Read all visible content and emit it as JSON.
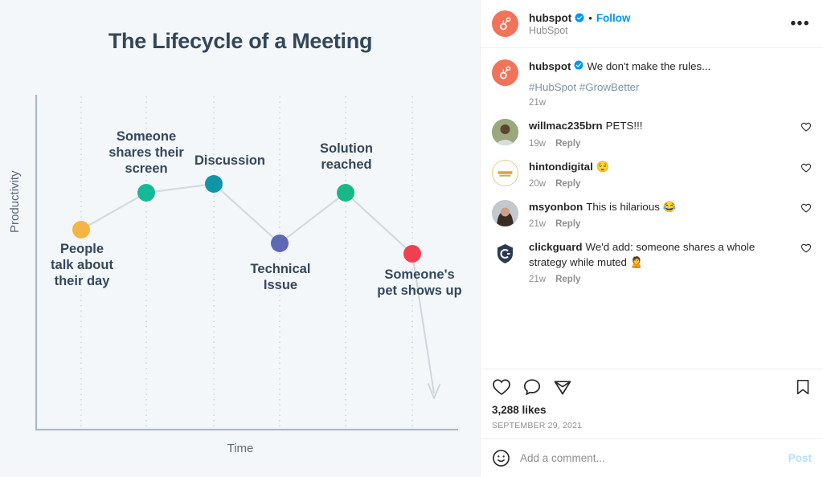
{
  "chart_data": {
    "type": "line",
    "title": "The Lifecycle of a Meeting",
    "xlabel": "Time",
    "ylabel": "Productivity",
    "grid": "vertical-dotted",
    "legend": "none",
    "xlim": [
      0,
      6
    ],
    "ylim": [
      0,
      10
    ],
    "categories": [
      "People talk about their day",
      "Someone shares their screen",
      "Discussion",
      "Technical Issue",
      "Solution reached",
      "Someone's pet shows up"
    ],
    "values": [
      4.6,
      6.4,
      6.8,
      4.0,
      6.4,
      3.5
    ],
    "points": [
      {
        "label": "People\ntalk about\ntheir day",
        "x": 1,
        "y": 4.6,
        "color": "#f5b544",
        "label_pos": "below"
      },
      {
        "label": "Someone\nshares their\nscreen",
        "x": 2,
        "y": 6.4,
        "color": "#17b897",
        "label_pos": "above"
      },
      {
        "label": "Discussion",
        "x": 3,
        "y": 6.8,
        "color": "#0f94a8",
        "label_pos": "above"
      },
      {
        "label": "Technical\nIssue",
        "x": 4,
        "y": 4.0,
        "color": "#5f68b5",
        "label_pos": "below"
      },
      {
        "label": "Solution\nreached",
        "x": 5,
        "y": 6.4,
        "color": "#17b887",
        "label_pos": "above"
      },
      {
        "label": "Someone's\npet shows up",
        "x": 6,
        "y": 3.5,
        "color": "#f0404f",
        "label_pos": "below"
      }
    ],
    "annotation": "downward arrow off the chart after final point",
    "background_color": "#f4f7fa",
    "title_color": "#33475b",
    "line_color": "#d2d9e0"
  },
  "post": {
    "header": {
      "username": "hubspot",
      "separator": "•",
      "follow_label": "Follow",
      "display_name": "HubSpot",
      "more_label": "•••",
      "avatar_color": "#f2725a"
    },
    "caption": {
      "username": "hubspot",
      "text": "We don't make the rules...",
      "hashtags": "#HubSpot #GrowBetter",
      "time": "21w"
    },
    "comments": [
      {
        "username": "willmac235brn",
        "text": "PETS!!!",
        "time": "19w",
        "reply_label": "Reply",
        "avatar_color": "#7f8d6b"
      },
      {
        "username": "hintondigital",
        "text": "😌",
        "time": "20w",
        "reply_label": "Reply",
        "avatar_color": "#f7d794"
      },
      {
        "username": "msyonbon",
        "text": "This is hilarious 😂",
        "time": "21w",
        "reply_label": "Reply",
        "avatar_color": "#6d5a55"
      },
      {
        "username": "clickguard",
        "text": "We'd add: someone shares a whole strategy while muted 🙎",
        "time": "21w",
        "reply_label": "Reply",
        "avatar_color": "#2b3a52"
      }
    ],
    "actions": {
      "like_icon": "heart-icon",
      "comment_icon": "comment-bubble-icon",
      "share_icon": "share-paper-plane-icon",
      "save_icon": "bookmark-icon"
    },
    "likes": "3,288 likes",
    "date": "SEPTEMBER 29, 2021",
    "add_comment": {
      "emoji_icon": "emoji-smiley-icon",
      "placeholder": "Add a comment...",
      "post_label": "Post"
    }
  },
  "colors": {
    "accent_blue": "#0095f6",
    "hashtag_blue": "#7a93ab",
    "muted": "#8e8e8e",
    "text": "#262626"
  }
}
